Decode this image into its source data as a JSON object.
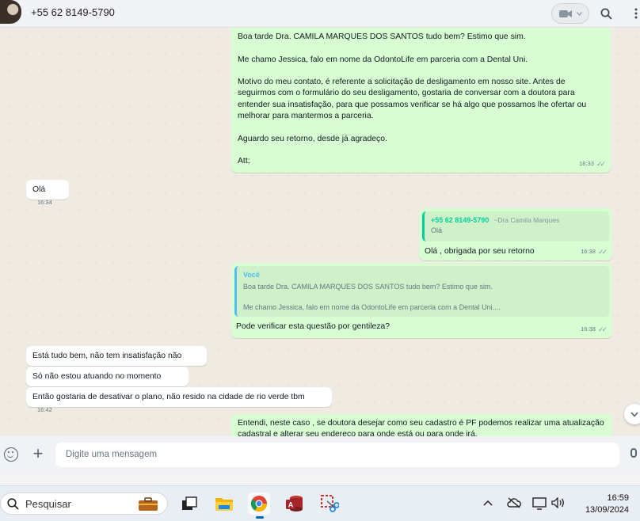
{
  "header": {
    "contact_name": "+55 62 8149-5790"
  },
  "messages": [
    {
      "id": "m1",
      "direction": "outgoing",
      "text": "Boa tarde Dra. CAMILA MARQUES DOS SANTOS tudo bem? Estimo que sim.\n\nMe chamo Jessica, falo em nome da OdontoLife em parceria com a Dental Uni.\n\nMotivo do meu contato, é referente a solicitação de desligamento em nosso site. Antes de\nseguirmos com o formulário do seu desligamento, gostaria de conversar com a doutora para\nentender sua insatisfação, para que possamos verificar se há algo que possamos lhe ofertar ou\nmelhorar para mantermos a parceria.\n\nAguardo seu retorno, desde já agradeço.\n\nAtt;",
      "time": "16:33",
      "status": "read"
    },
    {
      "id": "m2",
      "direction": "incoming",
      "text": "Olá",
      "time": "16:34"
    },
    {
      "id": "m3",
      "direction": "outgoing",
      "quote": {
        "author": "+55 62 8149-5790",
        "author_sub": "~Dra Camila Marques",
        "text": "Olá"
      },
      "text": "Olá , obrigada por seu retorno",
      "time": "16:38",
      "status": "read"
    },
    {
      "id": "m4",
      "direction": "outgoing",
      "quote": {
        "author": "Você",
        "text": "Boa tarde Dra. CAMILA MARQUES DOS SANTOS tudo bem? Estimo que sim.\n\nMe chamo Jessica, falo em nome da OdontoLife em parceria com a Dental Uni...."
      },
      "text": "Pode verificar esta questão por gentileza?",
      "time": "16:38",
      "status": "read"
    },
    {
      "id": "m5",
      "direction": "incoming",
      "text": "Está tudo bem, não tem insatisfação não",
      "time": "16:42"
    },
    {
      "id": "m6",
      "direction": "incoming",
      "text": "Só não estou atuando no momento",
      "time": "16:42"
    },
    {
      "id": "m7",
      "direction": "incoming",
      "text": "Então gostaria de desativar o plano, não resido na cidade de rio verde tbm",
      "time": "16:42"
    },
    {
      "id": "m8",
      "direction": "outgoing",
      "text": "Entendi, neste caso , se doutora desejar como seu cadastro é PF podemos realizar uma atualização\ncadastral e alterar seu endereço para onde está ou para onde irá.",
      "time": "",
      "status": "read"
    }
  ],
  "composer": {
    "placeholder": "Digite uma mensagem"
  },
  "taskbar": {
    "search_label": "Pesquisar",
    "time": "16:59",
    "date": "13/09/2024"
  },
  "colors": {
    "outgoing_bubble": "#d9fdd3",
    "incoming_bubble": "#ffffff",
    "chat_background": "#efeae2",
    "accent_green": "#06cf9c",
    "accent_blue": "#53bdeb",
    "read_ticks": "#8696a0"
  },
  "icons": [
    "avatar",
    "video-call-icon",
    "search-icon",
    "menu-icon",
    "scroll-down-icon",
    "emoji-icon",
    "attach-plus-icon",
    "mic-icon",
    "windows-search-icon",
    "briefcase-icon",
    "task-view-icon",
    "file-explorer-icon",
    "chrome-icon",
    "access-icon",
    "snipping-tool-icon",
    "chevron-up-icon",
    "cloud-off-icon",
    "display-icon",
    "speaker-icon"
  ]
}
